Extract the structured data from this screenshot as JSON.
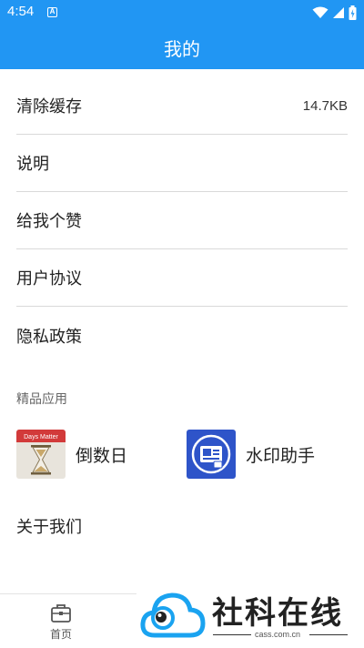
{
  "status_bar": {
    "time": "4:54",
    "notification_letter": "A"
  },
  "header": {
    "title": "我的"
  },
  "menu": {
    "clear_cache": {
      "label": "清除缓存",
      "value": "14.7KB"
    },
    "instructions": {
      "label": "说明"
    },
    "like": {
      "label": "给我个赞"
    },
    "user_agreement": {
      "label": "用户协议"
    },
    "privacy_policy": {
      "label": "隐私政策"
    }
  },
  "featured_apps": {
    "title": "精品应用",
    "items": [
      {
        "name": "倒数日",
        "icon": "hourglass-icon",
        "icon_caption": "Days Matter"
      },
      {
        "name": "水印助手",
        "icon": "watermark-app-icon"
      }
    ]
  },
  "about": {
    "label": "关于我们"
  },
  "bottom_nav": {
    "home_label": "首页"
  },
  "watermark": {
    "brand": "社科在线",
    "domain": "cass.com.cn"
  },
  "colors": {
    "primary": "#2196f3",
    "watermark_icon": "#1aa3f0",
    "divider": "#d9d9d9"
  }
}
